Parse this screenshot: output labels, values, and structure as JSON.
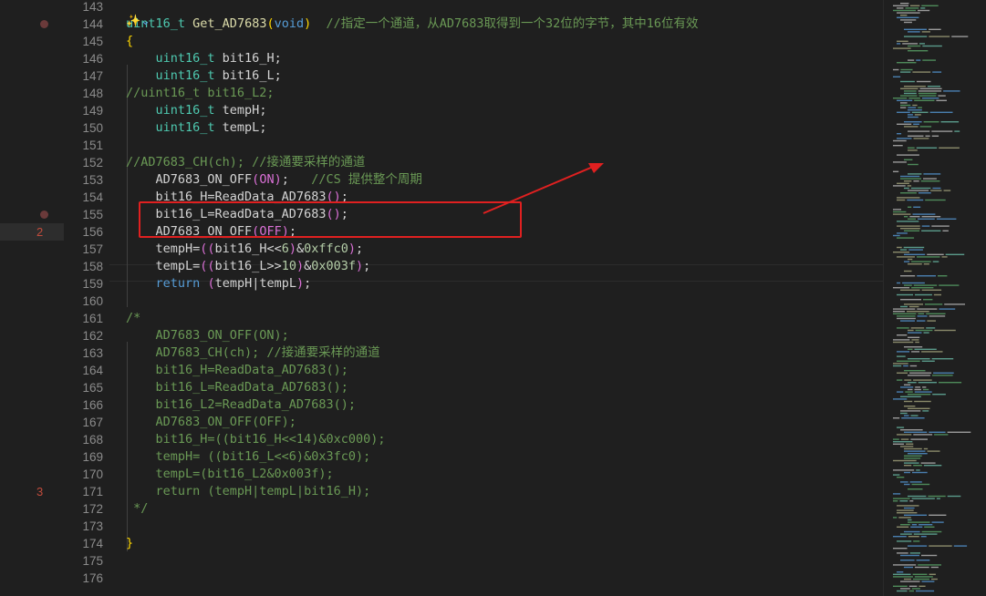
{
  "gutter": {
    "breakpoints": [
      {
        "line": 144
      },
      {
        "line": 155
      }
    ],
    "marks": [
      {
        "line": 156,
        "label": "2",
        "band": true
      },
      {
        "line": 171,
        "label": "3",
        "band": false
      }
    ]
  },
  "lines": [
    {
      "num": "143",
      "tokens": []
    },
    {
      "num": "144",
      "tokens": [
        {
          "t": "uint16_t",
          "c": "ty"
        },
        {
          "t": " "
        },
        {
          "t": "Get_AD7683",
          "c": "fn"
        },
        {
          "t": "(",
          "c": "pb"
        },
        {
          "t": "void",
          "c": "kw"
        },
        {
          "t": ")",
          "c": "pb"
        },
        {
          "t": "  "
        },
        {
          "t": "//指定一个通道，从AD7683取得到一个32位的字节，其中16位有效",
          "c": "cm"
        }
      ]
    },
    {
      "num": "145",
      "tokens": [
        {
          "t": "{",
          "c": "pb"
        }
      ]
    },
    {
      "num": "146",
      "tokens": [
        {
          "t": "    "
        },
        {
          "t": "uint16_t",
          "c": "ty"
        },
        {
          "t": " bit16_H;"
        }
      ]
    },
    {
      "num": "147",
      "tokens": [
        {
          "t": "    "
        },
        {
          "t": "uint16_t",
          "c": "ty"
        },
        {
          "t": " bit16_L;"
        }
      ]
    },
    {
      "num": "148",
      "tokens": [
        {
          "t": "//uint16_t bit16_L2;",
          "c": "cm"
        }
      ]
    },
    {
      "num": "149",
      "tokens": [
        {
          "t": "    "
        },
        {
          "t": "uint16_t",
          "c": "ty"
        },
        {
          "t": " tempH;"
        }
      ]
    },
    {
      "num": "150",
      "tokens": [
        {
          "t": "    "
        },
        {
          "t": "uint16_t",
          "c": "ty"
        },
        {
          "t": " tempL;"
        }
      ]
    },
    {
      "num": "151",
      "tokens": []
    },
    {
      "num": "152",
      "tokens": [
        {
          "t": "//AD7683_CH(ch); //接通要采样的通道",
          "c": "cm"
        }
      ]
    },
    {
      "num": "153",
      "tokens": [
        {
          "t": "    AD7683_ON_OFF"
        },
        {
          "t": "(",
          "c": "pu"
        },
        {
          "t": "ON",
          "c": "pu"
        },
        {
          "t": ")",
          "c": "pu"
        },
        {
          "t": ";   "
        },
        {
          "t": "//CS 提供整个周期",
          "c": "cm"
        }
      ]
    },
    {
      "num": "154",
      "tokens": [
        {
          "t": "    bit16_H=ReadData_AD7683"
        },
        {
          "t": "()",
          "c": "pu"
        },
        {
          "t": ";"
        }
      ]
    },
    {
      "num": "155",
      "tokens": [
        {
          "t": "    bit16_L=ReadData_AD7683"
        },
        {
          "t": "()",
          "c": "pu"
        },
        {
          "t": ";"
        }
      ]
    },
    {
      "num": "156",
      "tokens": [
        {
          "t": "    AD7683_ON_OFF"
        },
        {
          "t": "(",
          "c": "pu"
        },
        {
          "t": "OFF",
          "c": "pu"
        },
        {
          "t": ")",
          "c": "pu"
        },
        {
          "t": ";"
        }
      ]
    },
    {
      "num": "157",
      "tokens": [
        {
          "t": "    tempH="
        },
        {
          "t": "((",
          "c": "pu"
        },
        {
          "t": "bit16_H<<"
        },
        {
          "t": "6",
          "c": "nu"
        },
        {
          "t": ")",
          "c": "pu"
        },
        {
          "t": "&"
        },
        {
          "t": "0xffc0",
          "c": "nu"
        },
        {
          "t": ")",
          "c": "pu"
        },
        {
          "t": ";"
        }
      ]
    },
    {
      "num": "158",
      "tokens": [
        {
          "t": "    tempL="
        },
        {
          "t": "((",
          "c": "pu"
        },
        {
          "t": "bit16_L>>"
        },
        {
          "t": "10",
          "c": "nu"
        },
        {
          "t": ")",
          "c": "pu"
        },
        {
          "t": "&"
        },
        {
          "t": "0x003f",
          "c": "nu"
        },
        {
          "t": ")",
          "c": "pu"
        },
        {
          "t": ";"
        }
      ]
    },
    {
      "num": "159",
      "tokens": [
        {
          "t": "    "
        },
        {
          "t": "return",
          "c": "kw"
        },
        {
          "t": " "
        },
        {
          "t": "(",
          "c": "pu"
        },
        {
          "t": "tempH|tempL"
        },
        {
          "t": ")",
          "c": "pu"
        },
        {
          "t": ";"
        }
      ]
    },
    {
      "num": "160",
      "tokens": []
    },
    {
      "num": "161",
      "tokens": [
        {
          "t": "/*",
          "c": "cm"
        }
      ]
    },
    {
      "num": "162",
      "tokens": [
        {
          "t": "    AD7683_ON_OFF(ON);",
          "c": "cm"
        }
      ]
    },
    {
      "num": "163",
      "tokens": [
        {
          "t": "    AD7683_CH(ch); //接通要采样的通道",
          "c": "cm"
        }
      ]
    },
    {
      "num": "164",
      "tokens": [
        {
          "t": "    bit16_H=ReadData_AD7683();",
          "c": "cm"
        }
      ]
    },
    {
      "num": "165",
      "tokens": [
        {
          "t": "    bit16_L=ReadData_AD7683();",
          "c": "cm"
        }
      ]
    },
    {
      "num": "166",
      "tokens": [
        {
          "t": "    bit16_L2=ReadData_AD7683();",
          "c": "cm"
        }
      ]
    },
    {
      "num": "167",
      "tokens": [
        {
          "t": "    AD7683_ON_OFF(OFF);",
          "c": "cm"
        }
      ]
    },
    {
      "num": "168",
      "tokens": [
        {
          "t": "    bit16_H=((bit16_H<<14)&0xc000);",
          "c": "cm"
        }
      ]
    },
    {
      "num": "169",
      "tokens": [
        {
          "t": "    tempH= ((bit16_L<<6)&0x3fc0);",
          "c": "cm"
        }
      ]
    },
    {
      "num": "170",
      "tokens": [
        {
          "t": "    tempL=(bit16_L2&0x003f);",
          "c": "cm"
        }
      ]
    },
    {
      "num": "171",
      "tokens": [
        {
          "t": "    return (tempH|tempL|bit16_H);",
          "c": "cm"
        }
      ]
    },
    {
      "num": "172",
      "tokens": [
        {
          "t": " */",
          "c": "cm"
        }
      ]
    },
    {
      "num": "173",
      "tokens": []
    },
    {
      "num": "174",
      "tokens": [
        {
          "t": "}",
          "c": "pb"
        }
      ]
    },
    {
      "num": "175",
      "tokens": []
    },
    {
      "num": "176",
      "tokens": []
    }
  ],
  "codelens_icon": "sparkle-chevron-icon",
  "annotation": {
    "box_color": "#e02020",
    "arrow_color": "#e02020"
  }
}
